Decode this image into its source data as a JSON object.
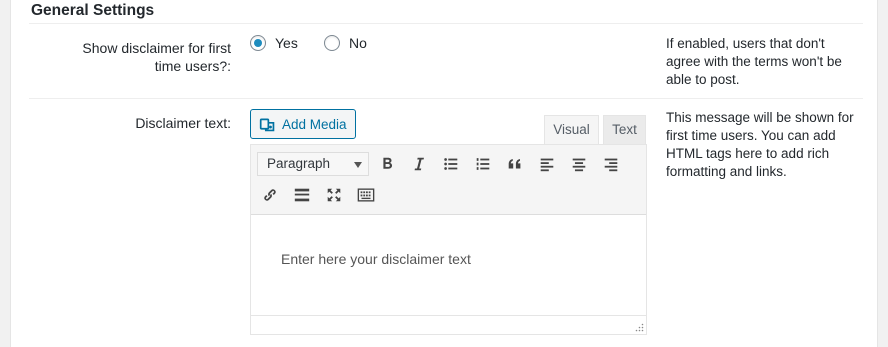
{
  "section": {
    "title": "General Settings"
  },
  "disclaimer_toggle": {
    "label": "Show disclaimer for first time users?:",
    "label_line1": "Show disclaimer for first",
    "label_line2": "time users?:",
    "options": [
      {
        "label": "Yes",
        "checked": true
      },
      {
        "label": "No",
        "checked": false
      }
    ],
    "description": "If enabled, users that don't agree with the terms won't be able to post."
  },
  "disclaimer_text": {
    "label": "Disclaimer text:",
    "add_media_label": "Add Media",
    "tabs": [
      {
        "label": "Visual",
        "active": true
      },
      {
        "label": "Text",
        "active": false
      }
    ],
    "format_select": "Paragraph",
    "toolbar_icons": [
      "bold-icon",
      "italic-icon",
      "bulleted-list-icon",
      "numbered-list-icon",
      "blockquote-icon",
      "align-left-icon",
      "align-center-icon",
      "align-right-icon",
      "link-icon",
      "read-more-icon",
      "fullscreen-icon",
      "toolbar-toggle-icon"
    ],
    "content_placeholder": "Enter here your disclaimer text",
    "description": "This message will be shown for first time users. You can add HTML tags here to add rich formatting and links."
  },
  "colors": {
    "accent": "#0071a1",
    "radio": "#1e8cbe",
    "background": "#f1f1f1"
  }
}
